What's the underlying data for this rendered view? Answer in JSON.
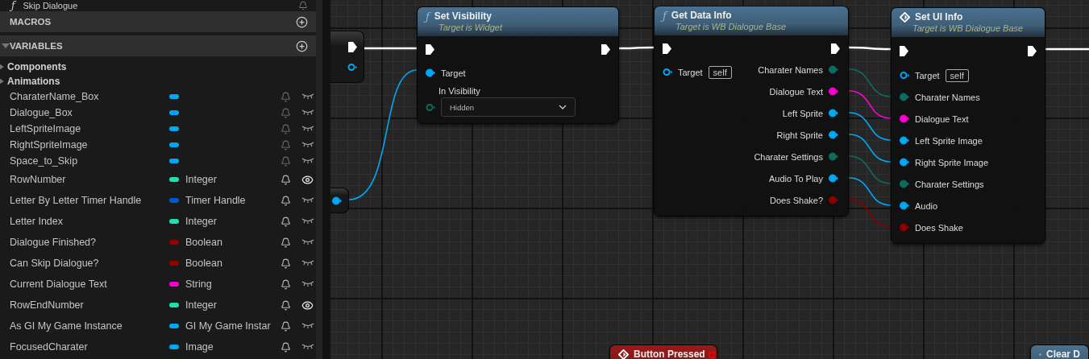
{
  "sidebar": {
    "top_item": {
      "icon": "ƒ",
      "label": "Skip Dialogue"
    },
    "sections": [
      {
        "title": "MACROS"
      },
      {
        "title": "VARIABLES",
        "expanded": true
      }
    ],
    "categories": [
      {
        "label": "Components",
        "expanded": false
      },
      {
        "label": "Animations",
        "expanded": false
      }
    ],
    "variables": [
      {
        "name": "CharaterName_Box",
        "color": "#00a8f4",
        "visible": false
      },
      {
        "name": "Dialogue_Box",
        "color": "#00a8f4",
        "visible": false
      },
      {
        "name": "LeftSpriteImage",
        "color": "#00a8f4",
        "visible": false
      },
      {
        "name": "RightSpriteImage",
        "color": "#00a8f4",
        "visible": false
      },
      {
        "name": "Space_to_Skip",
        "color": "#00a8f4",
        "visible": false
      },
      {
        "name": "RowNumber",
        "type": "Integer",
        "color": "#1fe0b0",
        "visible": true
      },
      {
        "name": "Letter By Letter Timer Handle",
        "type": "Timer Handle",
        "color": "#0059d1",
        "visible": false
      },
      {
        "name": "Letter Index",
        "type": "Integer",
        "color": "#1fe0b0",
        "visible": false
      },
      {
        "name": "Dialogue Finished?",
        "type": "Boolean",
        "color": "#950000",
        "visible": false
      },
      {
        "name": "Can Skip Dialogue?",
        "type": "Boolean",
        "color": "#950000",
        "visible": false
      },
      {
        "name": "Current Dialogue Text",
        "type": "String",
        "color": "#fa00d2",
        "visible": false
      },
      {
        "name": "RowEndNumber",
        "type": "Integer",
        "color": "#1fe0b0",
        "visible": true
      },
      {
        "name": "As GI My Game Instance",
        "type": "GI My Game Instar",
        "color": "#00a8f4",
        "visible": false
      },
      {
        "name": "FocusedCharater",
        "type": "Image",
        "color": "#00a8f4",
        "visible": false
      }
    ]
  },
  "graph": {
    "nodes": [
      {
        "kind": "stub",
        "pins": [
          {
            "kind": "exec"
          },
          {
            "kind": "data",
            "color": "#00a8f4",
            "connected": false
          }
        ]
      },
      {
        "kind": "stub",
        "pins": [
          {
            "kind": "data",
            "color": "#00a8f4",
            "connected": true
          }
        ]
      },
      {
        "kind": "function",
        "icon": "ƒ",
        "title": "Set Visibility",
        "subtitle": "Target is Widget",
        "color": "#4a7190",
        "inputs": [
          {
            "kind": "pin",
            "label": "Target",
            "color": "#00a8f4",
            "connected": true
          },
          {
            "kind": "select",
            "label": "In Visibility",
            "value": "Hidden",
            "color": "#0f6b5e",
            "connected": false
          }
        ]
      },
      {
        "kind": "function",
        "icon": "ƒ",
        "title": "Get Data Info",
        "subtitle": "Target is WB Dialogue Base",
        "color": "#4a7190",
        "inputs": [
          {
            "kind": "self",
            "label": "Target",
            "value": "self",
            "color": "#00a8f4",
            "connected": false
          }
        ],
        "outputs": [
          {
            "label": "Charater Names",
            "color": "#0f6b5e",
            "connected": true
          },
          {
            "label": "Dialogue Text",
            "color": "#fa00d2",
            "connected": true
          },
          {
            "label": "Left Sprite",
            "color": "#00a8f4",
            "connected": true
          },
          {
            "label": "Right Sprite",
            "color": "#00a8f4",
            "connected": true
          },
          {
            "label": "Charater Settings",
            "color": "#0f6b5e",
            "connected": true
          },
          {
            "label": "Audio To Play",
            "color": "#00a8f4",
            "connected": true
          },
          {
            "label": "Does Shake?",
            "color": "#8a0000",
            "connected": true
          }
        ]
      },
      {
        "kind": "event",
        "title": "Set UI Info",
        "subtitle": "Target is WB Dialogue Base",
        "color": "#4a7190",
        "inputs": [
          {
            "kind": "self",
            "label": "Target",
            "value": "self",
            "color": "#00a8f4",
            "connected": false
          },
          {
            "kind": "pin",
            "label": "Charater Names",
            "color": "#0f6b5e",
            "connected": true
          },
          {
            "kind": "pin",
            "label": "Dialogue Text",
            "color": "#fa00d2",
            "connected": true
          },
          {
            "kind": "pin",
            "label": "Left Sprite Image",
            "color": "#00a8f4",
            "connected": true
          },
          {
            "kind": "pin",
            "label": "Right Sprite Image",
            "color": "#00a8f4",
            "connected": true
          },
          {
            "kind": "pin",
            "label": "Charater Settings",
            "color": "#0f6b5e",
            "connected": true
          },
          {
            "kind": "pin",
            "label": "Audio",
            "color": "#00a8f4",
            "connected": true
          },
          {
            "kind": "pin",
            "label": "Does Shake",
            "color": "#8a0000",
            "connected": true
          }
        ]
      },
      {
        "kind": "event",
        "title": "Button Pressed",
        "color": "#9a1a1a"
      },
      {
        "kind": "event",
        "title": "Clear D",
        "color": "#4a7190"
      }
    ]
  }
}
